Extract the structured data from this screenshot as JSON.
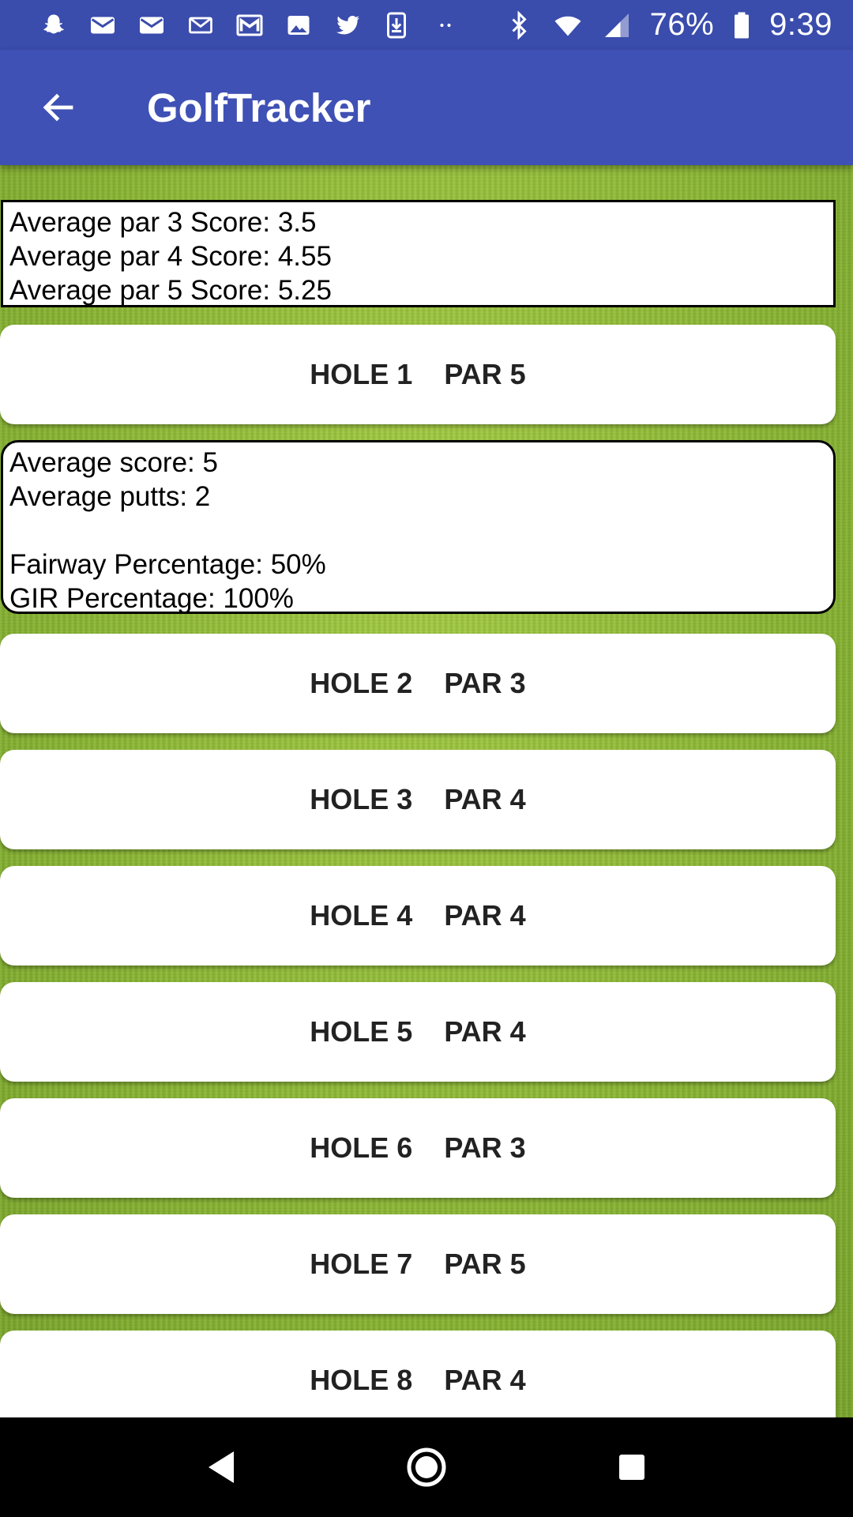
{
  "status_bar": {
    "battery_percent": "76%",
    "time": "9:39",
    "left_icons": [
      "snapchat-icon",
      "mail-icon",
      "mail-icon",
      "email-icon",
      "gmail-icon",
      "image-icon",
      "twitter-icon",
      "download-icon",
      "more-dots-icon"
    ],
    "right_icons": [
      "bluetooth-icon",
      "wifi-icon",
      "cell-signal-icon",
      "battery-icon"
    ]
  },
  "app_bar": {
    "title": "GolfTracker",
    "back_icon": "arrow-back-icon"
  },
  "summary": {
    "lines": [
      "Average par 3 Score: 3.5",
      "Average par 4 Score: 4.55",
      "Average par 5 Score: 5.25"
    ]
  },
  "holes": [
    {
      "label": "HOLE 1    PAR 5"
    },
    {
      "label": "HOLE 2    PAR 3"
    },
    {
      "label": "HOLE 3    PAR 4"
    },
    {
      "label": "HOLE 4    PAR 4"
    },
    {
      "label": "HOLE 5    PAR 4"
    },
    {
      "label": "HOLE 6    PAR 3"
    },
    {
      "label": "HOLE 7    PAR 5"
    },
    {
      "label": "HOLE 8    PAR 4"
    }
  ],
  "hole1_details": {
    "average_score": "Average score: 5",
    "average_putts": "Average putts: 2",
    "fairway": "Fairway Percentage: 50%",
    "gir": "GIR Percentage: 100%"
  },
  "nav_bar": {
    "icons": [
      "back-triangle-icon",
      "home-circle-icon",
      "recents-square-icon"
    ]
  },
  "colors": {
    "status_bar": "#3a4cac",
    "app_bar": "#3f51b5",
    "grass": "#8fbd3a"
  }
}
